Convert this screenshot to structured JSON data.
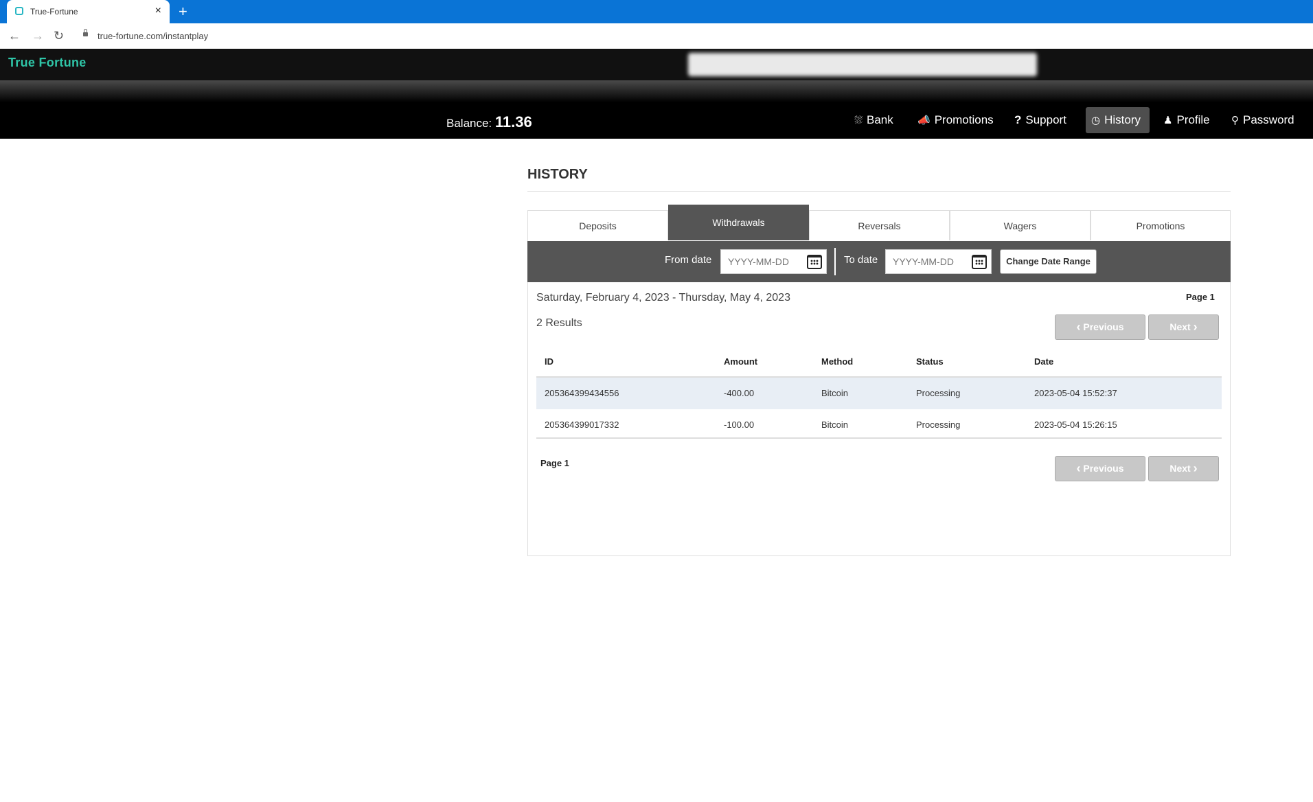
{
  "browser": {
    "tab_title": "True-Fortune",
    "tab_close": "×",
    "new_tab": "+",
    "url": "true-fortune.com/instantplay"
  },
  "site": {
    "logo": "True Fortune",
    "balance_label": "Balance:",
    "balance_value": "11.36",
    "menu": [
      {
        "label": "Bank",
        "icon": "money-icon"
      },
      {
        "label": "Promotions",
        "icon": "megaphone-icon"
      },
      {
        "label": "Support",
        "icon": "question-icon"
      },
      {
        "label": "History",
        "icon": "history-icon",
        "active": true
      },
      {
        "label": "Profile",
        "icon": "user-icon"
      },
      {
        "label": "Password",
        "icon": "key-icon"
      }
    ]
  },
  "history": {
    "title": "HISTORY",
    "tabs": [
      {
        "label": "Deposits"
      },
      {
        "label": "Withdrawals",
        "active": true
      },
      {
        "label": "Reversals"
      },
      {
        "label": "Wagers"
      },
      {
        "label": "Promotions"
      }
    ],
    "filter": {
      "from_label": "From date",
      "from_placeholder": "YYYY-MM-DD",
      "to_label": "To date",
      "to_placeholder": "YYYY-MM-DD",
      "change_button": "Change Date Range"
    },
    "range_text": "Saturday, February 4, 2023 - Thursday, May 4, 2023",
    "page_label": "Page 1",
    "results_text": "2 Results",
    "previous_label": "Previous",
    "next_label": "Next",
    "table": {
      "headers": [
        "ID",
        "Amount",
        "Method",
        "Status",
        "Date"
      ],
      "rows": [
        [
          "205364399434556",
          "-400.00",
          "Bitcoin",
          "Processing",
          "2023-05-04 15:52:37"
        ],
        [
          "205364399017332",
          "-100.00",
          "Bitcoin",
          "Processing",
          "2023-05-04 15:26:15"
        ]
      ]
    }
  },
  "colors": {
    "browser_blue": "#0a74d6",
    "logo_green": "#2fc6a8",
    "header_black": "#000000",
    "tab_active_gray": "#555555",
    "row_highlight": "#e8eef5"
  }
}
